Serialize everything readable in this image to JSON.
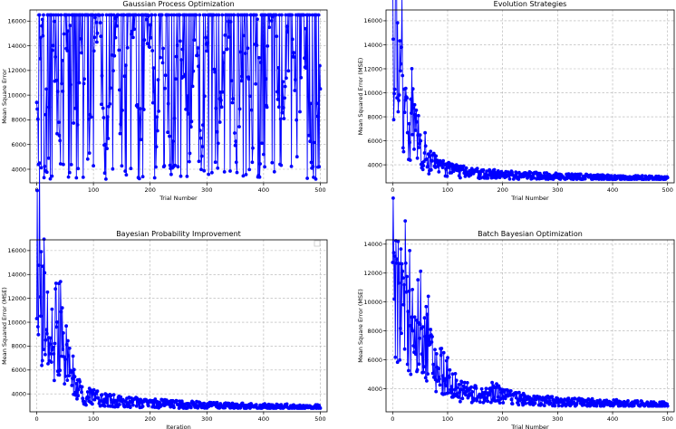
{
  "chart_data": [
    {
      "type": "line",
      "title": "Gaussian Process Optimization",
      "xlabel": "Trial Number",
      "ylabel": "Mean Square Error",
      "xlim": [
        -12,
        512
      ],
      "ylim": [
        2900,
        16900
      ],
      "xticks": [
        0,
        100,
        200,
        300,
        400,
        500
      ],
      "yticks": [
        4000,
        6000,
        8000,
        10000,
        12000,
        14000,
        16000
      ],
      "grid": true,
      "color": "#0000ff",
      "series": [
        {
          "pattern": "oscillating",
          "x_range": [
            0,
            500
          ],
          "y_min": 3200,
          "y_max": 16500,
          "values_every_10": [
            7000,
            16500,
            6000,
            15800,
            4500,
            16500,
            13000,
            5800,
            16500,
            3500,
            15000,
            16500,
            3300,
            9000,
            16500,
            6000,
            14500,
            16500,
            4500,
            12000,
            16500,
            5500,
            16500,
            9000,
            4000,
            16500,
            12000,
            6000,
            16500,
            3800,
            15000,
            16500,
            6200,
            14000,
            16500,
            3500,
            12500,
            16500,
            7000,
            16500,
            4500,
            15500,
            16500,
            6000,
            13000,
            16500,
            4000,
            16500,
            9000,
            3500,
            12500
          ]
        }
      ]
    },
    {
      "type": "line",
      "title": "Evolution Strategies",
      "xlabel": "Trial Number",
      "ylabel": "Mean Squared Error (MSE)",
      "xlim": [
        -12,
        512
      ],
      "ylim": [
        2500,
        16900
      ],
      "xticks": [
        0,
        100,
        200,
        300,
        400,
        500
      ],
      "yticks": [
        4000,
        6000,
        8000,
        10000,
        12000,
        14000,
        16000
      ],
      "grid": true,
      "color": "#0000ff",
      "series": [
        {
          "pattern": "decay",
          "x_range": [
            0,
            500
          ],
          "values_every_10": [
            14200,
            12500,
            8500,
            7200,
            6500,
            6000,
            4500,
            4200,
            3900,
            3700,
            3600,
            3500,
            3450,
            3400,
            3350,
            3300,
            3300,
            3250,
            3250,
            3200,
            3200,
            3150,
            3150,
            3100,
            3100,
            3100,
            3100,
            3050,
            3050,
            3050,
            3050,
            3000,
            3000,
            3000,
            3000,
            3000,
            2950,
            2950,
            2950,
            2950,
            2950,
            2900,
            2900,
            2900,
            2900,
            2900,
            2900,
            2900,
            2900,
            2850,
            2850
          ]
        }
      ]
    },
    {
      "type": "line",
      "title": "Bayesian Probability Improvement",
      "xlabel": "Iteration",
      "ylabel": "Mean Squared Error (MSE)",
      "xlim": [
        -12,
        512
      ],
      "ylim": [
        2500,
        16900
      ],
      "xticks": [
        0,
        100,
        200,
        300,
        400,
        500
      ],
      "yticks": [
        4000,
        6000,
        8000,
        10000,
        12000,
        14000,
        16000
      ],
      "grid": true,
      "color": "#0000ff",
      "series": [
        {
          "pattern": "decay",
          "x_range": [
            0,
            500
          ],
          "values_every_10": [
            14500,
            10500,
            6800,
            6200,
            9000,
            7500,
            5600,
            4400,
            4000,
            3800,
            3700,
            3600,
            3500,
            3450,
            3400,
            3350,
            3300,
            3300,
            3250,
            3250,
            3200,
            3200,
            3200,
            3150,
            3150,
            3100,
            3100,
            3100,
            3100,
            3050,
            3050,
            3050,
            3050,
            3000,
            3000,
            3000,
            3000,
            3000,
            3000,
            2950,
            2950,
            2950,
            2950,
            2950,
            2950,
            2900,
            2900,
            2900,
            2900,
            2900,
            2900
          ]
        }
      ]
    },
    {
      "type": "line",
      "title": "Batch Bayesian Optimization",
      "xlabel": "Trial Number",
      "ylabel": "Mean Square Error (MSE)",
      "xlim": [
        -12,
        512
      ],
      "ylim": [
        2400,
        14300
      ],
      "xticks": [
        0,
        100,
        200,
        300,
        400,
        500
      ],
      "yticks": [
        4000,
        6000,
        8000,
        10000,
        12000,
        14000
      ],
      "grid": true,
      "color": "#0000ff",
      "series": [
        {
          "pattern": "decay",
          "x_range": [
            0,
            500
          ],
          "values_every_10": [
            12500,
            10500,
            9000,
            8200,
            7500,
            7000,
            6500,
            6000,
            5500,
            5200,
            4800,
            4300,
            4000,
            3800,
            3700,
            3600,
            3550,
            3500,
            3800,
            3700,
            3450,
            3400,
            3350,
            3300,
            3250,
            3250,
            3200,
            3200,
            3150,
            3150,
            3100,
            3100,
            3100,
            3100,
            3050,
            3050,
            3050,
            3000,
            3000,
            3000,
            3000,
            3000,
            2950,
            2950,
            2950,
            2950,
            2900,
            2900,
            2900,
            2900,
            2900
          ]
        }
      ]
    }
  ]
}
